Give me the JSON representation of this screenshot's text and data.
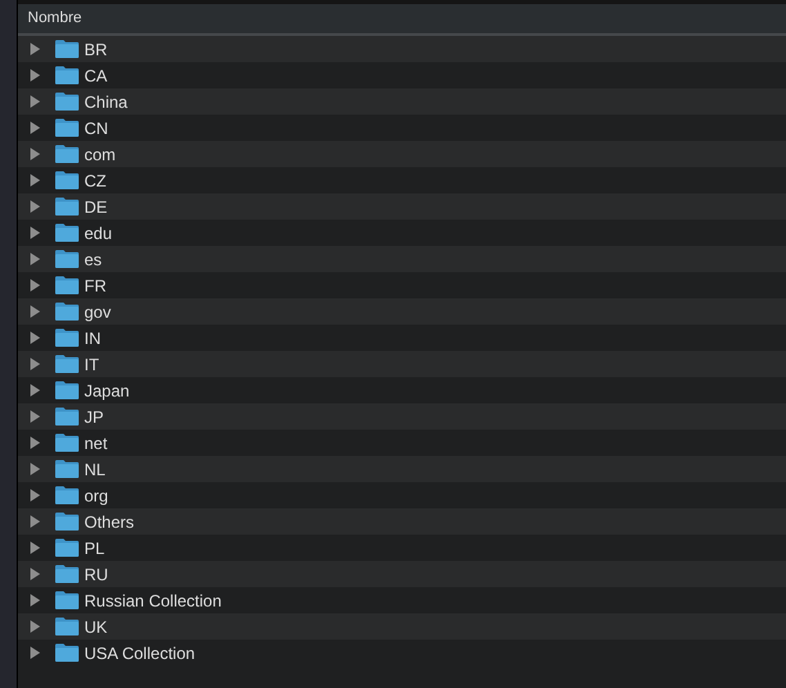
{
  "table": {
    "columns": [
      "Nombre"
    ],
    "rows": [
      {
        "name": "BR",
        "expanded": false
      },
      {
        "name": "CA",
        "expanded": false
      },
      {
        "name": "China",
        "expanded": false
      },
      {
        "name": "CN",
        "expanded": false
      },
      {
        "name": "com",
        "expanded": false
      },
      {
        "name": "CZ",
        "expanded": false
      },
      {
        "name": "DE",
        "expanded": false
      },
      {
        "name": "edu",
        "expanded": false
      },
      {
        "name": "es",
        "expanded": false
      },
      {
        "name": "FR",
        "expanded": false
      },
      {
        "name": "gov",
        "expanded": false
      },
      {
        "name": "IN",
        "expanded": false
      },
      {
        "name": "IT",
        "expanded": false
      },
      {
        "name": "Japan",
        "expanded": false
      },
      {
        "name": "JP",
        "expanded": false
      },
      {
        "name": "net",
        "expanded": false
      },
      {
        "name": "NL",
        "expanded": false
      },
      {
        "name": "org",
        "expanded": false
      },
      {
        "name": "Others",
        "expanded": false
      },
      {
        "name": "PL",
        "expanded": false
      },
      {
        "name": "RU",
        "expanded": false
      },
      {
        "name": "Russian Collection",
        "expanded": false
      },
      {
        "name": "UK",
        "expanded": false
      },
      {
        "name": "USA Collection",
        "expanded": false
      }
    ]
  }
}
